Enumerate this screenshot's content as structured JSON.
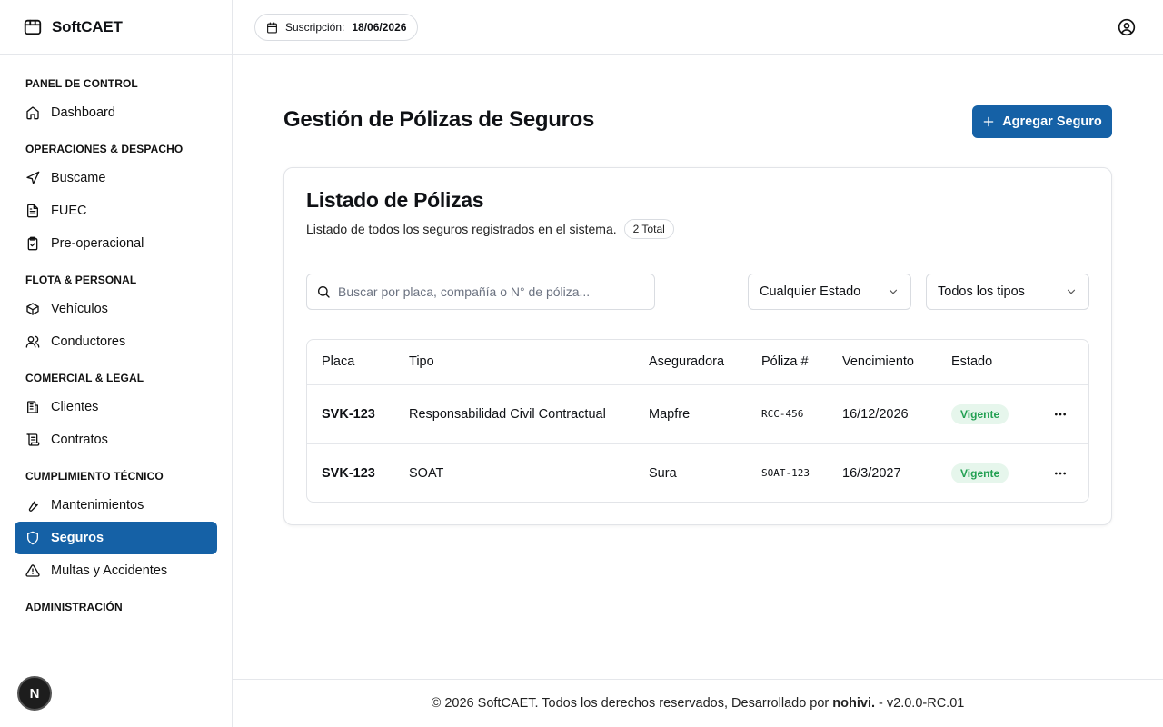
{
  "brand": {
    "name": "SoftCAET"
  },
  "header": {
    "subscription_label": "Suscripción:",
    "subscription_date": "18/06/2026"
  },
  "nav": {
    "sections": [
      {
        "title": "PANEL DE CONTROL",
        "items": [
          {
            "label": "Dashboard",
            "icon": "home-icon"
          }
        ]
      },
      {
        "title": "OPERACIONES & DESPACHO",
        "items": [
          {
            "label": "Buscame",
            "icon": "navigation-icon"
          },
          {
            "label": "FUEC",
            "icon": "file-text-icon"
          },
          {
            "label": "Pre-operacional",
            "icon": "clipboard-check-icon"
          }
        ]
      },
      {
        "title": "FLOTA & PERSONAL",
        "items": [
          {
            "label": "Vehículos",
            "icon": "package-icon"
          },
          {
            "label": "Conductores",
            "icon": "users-icon"
          }
        ]
      },
      {
        "title": "COMERCIAL & LEGAL",
        "items": [
          {
            "label": "Clientes",
            "icon": "building-icon"
          },
          {
            "label": "Contratos",
            "icon": "scroll-icon"
          }
        ]
      },
      {
        "title": "CUMPLIMIENTO TÉCNICO",
        "items": [
          {
            "label": "Mantenimientos",
            "icon": "wrench-icon"
          },
          {
            "label": "Seguros",
            "icon": "shield-icon",
            "active": true
          },
          {
            "label": "Multas y Accidentes",
            "icon": "alert-triangle-icon"
          }
        ]
      },
      {
        "title": "ADMINISTRACIÓN",
        "items": []
      }
    ]
  },
  "badge_letter": "N",
  "main": {
    "title": "Gestión de Pólizas de Seguros",
    "add_button": "Agregar Seguro",
    "card": {
      "title": "Listado de Pólizas",
      "description": "Listado de todos los seguros registrados en el sistema.",
      "total": "2 Total",
      "search_placeholder": "Buscar por placa, compañía o N° de póliza...",
      "filter_estado": "Cualquier Estado",
      "filter_tipos": "Todos los tipos"
    },
    "table": {
      "headers": [
        "Placa",
        "Tipo",
        "Aseguradora",
        "Póliza #",
        "Vencimiento",
        "Estado"
      ],
      "rows": [
        {
          "placa": "SVK-123",
          "tipo": "Responsabilidad Civil Contractual",
          "aseguradora": "Mapfre",
          "poliza": "RCC-456",
          "vencimiento": "16/12/2026",
          "estado": "Vigente"
        },
        {
          "placa": "SVK-123",
          "tipo": "SOAT",
          "aseguradora": "Sura",
          "poliza": "SOAT-123",
          "vencimiento": "16/3/2027",
          "estado": "Vigente"
        }
      ]
    }
  },
  "footer": {
    "prefix": "© 2026 SoftCAET. Todos los derechos reservados, Desarrollado por",
    "author": "nohivi.",
    "suffix": "- v2.0.0-RC.01"
  },
  "colors": {
    "accent": "#1561a6",
    "status_green": "#22a052",
    "status_green_bg": "#e6f6ec"
  }
}
